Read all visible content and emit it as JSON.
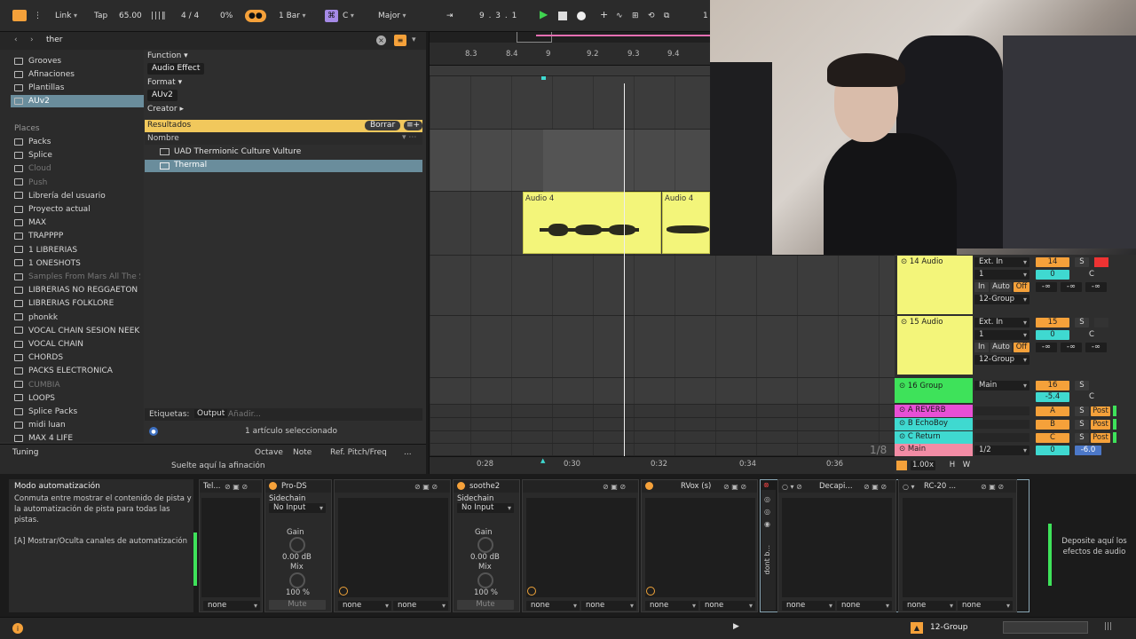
{
  "transport": {
    "link": "Link",
    "tap": "Tap",
    "tempo": "65.00",
    "signature": "4 / 4",
    "cpu": "0%",
    "quantize": "1 Bar",
    "key_root": "C",
    "key_scale": "Major",
    "position": "9 .  3 .  1",
    "extra": "1"
  },
  "browser": {
    "search_value": "ther",
    "sidebar_collections": [
      "Grooves",
      "Afinaciones",
      "Plantillas",
      "AUv2"
    ],
    "places_header": "Places",
    "places": [
      "Packs",
      "Splice",
      "Cloud",
      "Push",
      "Librería del usuario",
      "Proyecto actual",
      "MAX",
      "TRAPPPP",
      "1 LIBRERIAS",
      "1 ONESHOTS",
      "Samples From Mars All The S",
      "LIBRERIAS NO REGGAETON",
      "LIBRERIAS FOLKLORE",
      "phonkk",
      "VOCAL CHAIN SESION NEEK",
      "VOCAL CHAIN",
      "CHORDS",
      "PACKS ELECTRONICA",
      "CUMBIA",
      "LOOPS",
      "Splice Packs",
      "midi luan",
      "MAX 4 LIFE"
    ],
    "filter_function": "Function",
    "filter_function_value": "Audio Effect",
    "filter_format": "Format",
    "filter_format_value": "AUv2",
    "filter_creator": "Creator",
    "results_label": "Resultados",
    "clear_label": "Borrar",
    "col_name": "Nombre",
    "results": [
      "UAD Thermionic Culture Vulture",
      "Thermal"
    ],
    "tags_label": "Etiquetas:",
    "tags_output": "Output",
    "tags_add": "Añadir...",
    "status": "1 artículo seleccionado"
  },
  "tuning": {
    "label": "Tuning",
    "col_octave": "Octave",
    "col_note": "Note",
    "col_ref": "Ref. Pitch/Freq",
    "more": "...",
    "drop_hint": "Suelte aquí la afinación"
  },
  "ruler": {
    "bars": [
      "8.3",
      "8.4",
      "9",
      "9.2",
      "9.3",
      "9.4"
    ],
    "times": [
      "0:28",
      "0:30",
      "0:32",
      "0:34",
      "0:36"
    ],
    "zoom": "1/8"
  },
  "clips": [
    {
      "name": "Audio 4"
    },
    {
      "name": "Audio 4"
    }
  ],
  "tracks": [
    {
      "name": "14 Audio",
      "input": "Ext. In",
      "channel": "1",
      "in": "In",
      "auto": "Auto",
      "off": "Off",
      "out": "12-Group",
      "num": "14",
      "solo": "S",
      "pan": "0",
      "c": "C",
      "inf1": "-∞",
      "inf2": "-∞",
      "inf3": "-∞"
    },
    {
      "name": "15 Audio",
      "input": "Ext. In",
      "channel": "1",
      "in": "In",
      "auto": "Auto",
      "off": "Off",
      "out": "12-Group",
      "num": "15",
      "solo": "S",
      "pan": "0",
      "c": "C",
      "inf1": "-∞",
      "inf2": "-∞",
      "inf3": "-∞"
    }
  ],
  "group_track": {
    "name": "16 Group",
    "out": "Main",
    "num": "16",
    "solo": "S",
    "vol": "-5.4",
    "c": "C"
  },
  "returns": [
    {
      "name": "A REVERB",
      "letter": "A",
      "solo": "S",
      "post": "Post",
      "color": "#e84fd6"
    },
    {
      "name": "B EchoBoy",
      "letter": "B",
      "solo": "S",
      "post": "Post",
      "color": "#3fd9d0"
    },
    {
      "name": "C Return",
      "letter": "C",
      "solo": "S",
      "post": "Post",
      "color": "#3fd9d0"
    }
  ],
  "main_track": {
    "name": "Main",
    "out": "1/2",
    "pan": "0",
    "vol": "-6.0",
    "speed": "1.00x",
    "h": "H",
    "w": "W"
  },
  "info": {
    "title": "Modo automatización",
    "body": "Conmuta entre mostrar el contenido de pista y la automatización de pista para todas las pistas.",
    "shortcut": "[A] Mostrar/Oculta canales de automatización"
  },
  "devices": [
    {
      "name": "Tel...",
      "sel1": "none",
      "sel2": ""
    },
    {
      "name": "Pro-DS",
      "sidechain": "Sidechain",
      "input": "No Input",
      "gain_label": "Gain",
      "gain": "0.00 dB",
      "mix_label": "Mix",
      "mix": "100 %",
      "mute": "Mute"
    },
    {
      "name": "",
      "sel1": "none",
      "sel2": "none"
    },
    {
      "name": "soothe2",
      "sidechain": "Sidechain",
      "input": "No Input",
      "gain_label": "Gain",
      "gain": "0.00 dB",
      "mix_label": "Mix",
      "mix": "100 %",
      "mute": "Mute"
    },
    {
      "name": "",
      "sel1": "none",
      "sel2": "none"
    },
    {
      "name": "RVox (s)",
      "sel1": "none",
      "sel2": "none"
    },
    {
      "name": "Decapi...",
      "sel1": "none",
      "sel2": "none"
    },
    {
      "name": "RC-20 ...",
      "sel1": "none",
      "sel2": "none"
    }
  ],
  "rack_label": "dont b...",
  "drop_effects": "Deposite aquí los efectos de audio",
  "bottom": {
    "track": "12-Group"
  }
}
